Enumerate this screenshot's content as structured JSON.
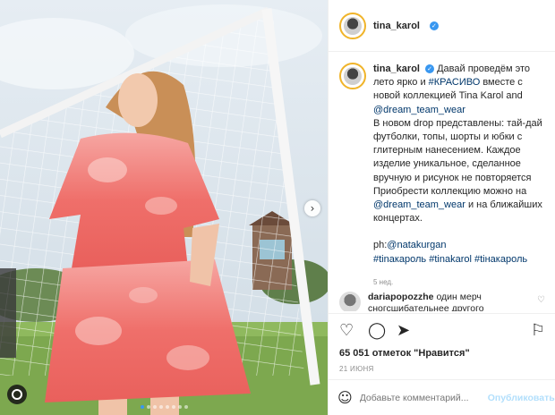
{
  "post": {
    "username": "tina_karol",
    "verified_mark": "✓"
  },
  "caption": {
    "author": "tina_karol",
    "line1_a": "Давай проведём это лето ярко  и ",
    "hashtag1": "#КРАСИВО",
    "line1_b": " вместе с новой коллекцией Tina Karol and ",
    "mention1": "@dream_team_wear",
    "para2": "В новом drop представлены: тай-дай футболки, топы, шорты и юбки с глитерным нанесением. Каждое изделие уникальное, сделанное вручную и рисунок не повторяется Приобрести коллекцию можно на ",
    "mention2": "@dream_team_wear",
    "para2_end": " и на ближайших концертах.",
    "credit_prefix": "ph:",
    "credit_handle": "@natakurgan",
    "tags": "#tinaкароль #tinakarol #tiнакароль",
    "time": "5 нед."
  },
  "comment": {
    "author": "dariapopozzhe",
    "text": "один мерч сногсшибательнее другого"
  },
  "actions": {
    "like_icon": "heart-icon",
    "comment_icon": "comment-icon",
    "share_icon": "share-icon",
    "save_icon": "bookmark-icon"
  },
  "likes_text": "65 051 отметок \"Нравится\"",
  "date": "21 ИЮНЯ",
  "add_comment": {
    "placeholder": "Добавьте комментарий...",
    "publish_label": "Опубликовать"
  },
  "carousel": {
    "active_index": 0,
    "count": 8
  },
  "colors": {
    "link": "#00376b",
    "accent": "#3897f0",
    "dress": "#ef6f6a"
  }
}
